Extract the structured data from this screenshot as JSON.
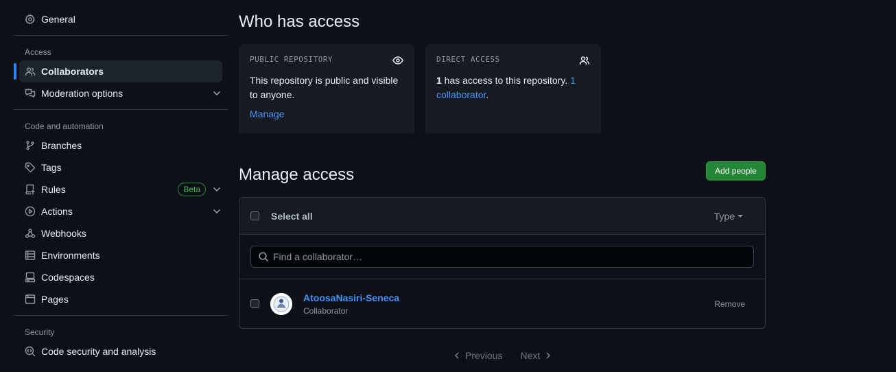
{
  "sidebar": {
    "general": "General",
    "access_heading": "Access",
    "collaborators": "Collaborators",
    "moderation": "Moderation options",
    "code_heading": "Code and automation",
    "branches": "Branches",
    "tags": "Tags",
    "rules": "Rules",
    "rules_badge": "Beta",
    "actions": "Actions",
    "webhooks": "Webhooks",
    "environments": "Environments",
    "codespaces": "Codespaces",
    "pages": "Pages",
    "security_heading": "Security",
    "code_security": "Code security and analysis"
  },
  "who_has_access": {
    "title": "Who has access",
    "public_card": {
      "label": "PUBLIC REPOSITORY",
      "text": "This repository is public and visible to anyone.",
      "link": "Manage"
    },
    "direct_card": {
      "label": "DIRECT ACCESS",
      "count": "1",
      "text": " has access to this repository. ",
      "link": "1 collaborator",
      "after": "."
    }
  },
  "manage_access": {
    "title": "Manage access",
    "add_button": "Add people",
    "select_all": "Select all",
    "type_filter": "Type",
    "search_placeholder": "Find a collaborator…",
    "collaborators": [
      {
        "name": "AtoosaNasiri-Seneca",
        "role": "Collaborator",
        "action": "Remove"
      }
    ]
  },
  "pagination": {
    "previous": "Previous",
    "next": "Next"
  },
  "colors": {
    "accent": "#2f81f7",
    "link": "#4493f8",
    "primary_button": "#238636",
    "background": "#0d1117"
  }
}
